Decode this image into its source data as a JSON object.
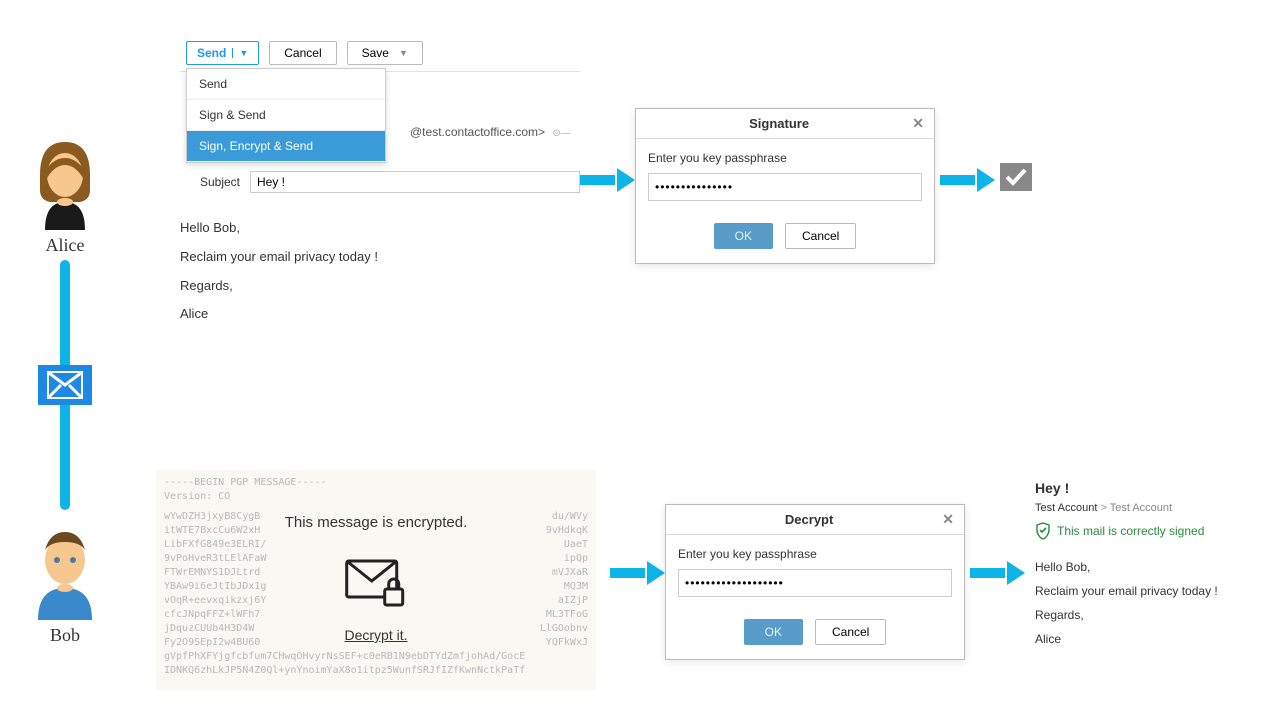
{
  "alice": {
    "label": "Alice"
  },
  "bob": {
    "label": "Bob"
  },
  "compose": {
    "toolbar": {
      "send": "Send",
      "cancel": "Cancel",
      "save": "Save"
    },
    "dropdown": {
      "item0": "Send",
      "item1": "Sign & Send",
      "item2": "Sign, Encrypt & Send"
    },
    "recipient": "@test.contactoffice.com>",
    "subject_label": "Subject",
    "subject_value": "Hey !",
    "body": {
      "l1": "Hello Bob,",
      "l2": "Reclaim your email privacy today !",
      "l3": "Regards,",
      "l4": "Alice"
    }
  },
  "dialog_sign": {
    "title": "Signature",
    "prompt": "Enter you key passphrase",
    "value": "•••••••••••••••",
    "ok": "OK",
    "cancel": "Cancel"
  },
  "dialog_decrypt": {
    "title": "Decrypt",
    "prompt": "Enter you key passphrase",
    "value": "•••••••••••••••••••",
    "ok": "OK",
    "cancel": "Cancel"
  },
  "encrypted": {
    "header": "-----BEGIN PGP MESSAGE-----",
    "version": "Version: CO",
    "msg": "This message is encrypted.",
    "link": "Decrypt it.",
    "lines": {
      "a": "wYwDZH3jxyB8CygB",
      "b": "itWTE7BxcCu6W2xH",
      "c": "LibFXfG849e3ELRI/",
      "d": "9vPoHveR3tLElAFaW",
      "e": "FTWrEMNYS1DJLtrd",
      "f": "YBAw9i6eJtIbJDx1g",
      "g": "vOqR+eevxqikzxj6Y",
      "h": "cfcJNpqFFZ+lWFh7",
      "i": "jDquzCUUb4H3D4W",
      "j": "Fy2O9SEpI2w4BU60",
      "k": "gVpfPhXFYjgfcbfum7CHwqOHvyrNsSEF+c0eRB1N9ebDTYdZmfjohAd/GocE",
      "l": "IDNKQ6zhLkJP5N4Z0Ql+ynYnoimYaX8o1itpz5WunfSRJfIZfKwnNctkPaTf",
      "r1": "du/WVy",
      "r2": "9vHdkqK",
      "r3": "UaeT",
      "r4": "ipQp",
      "r5": "mVJXaR",
      "r6": "MQ3M",
      "r7": "aIZjP",
      "r8": "ML3TFoG",
      "r9": "LlGOobnv",
      "r10": "YQFkWxJ"
    }
  },
  "decrypted": {
    "subject": "Hey !",
    "crumb1": "Test Account",
    "crumb2": "Test Account",
    "signed": "This mail is correctly signed",
    "body": {
      "l1": "Hello Bob,",
      "l2": "Reclaim your email privacy today !",
      "l3": "Regards,",
      "l4": "Alice"
    }
  }
}
